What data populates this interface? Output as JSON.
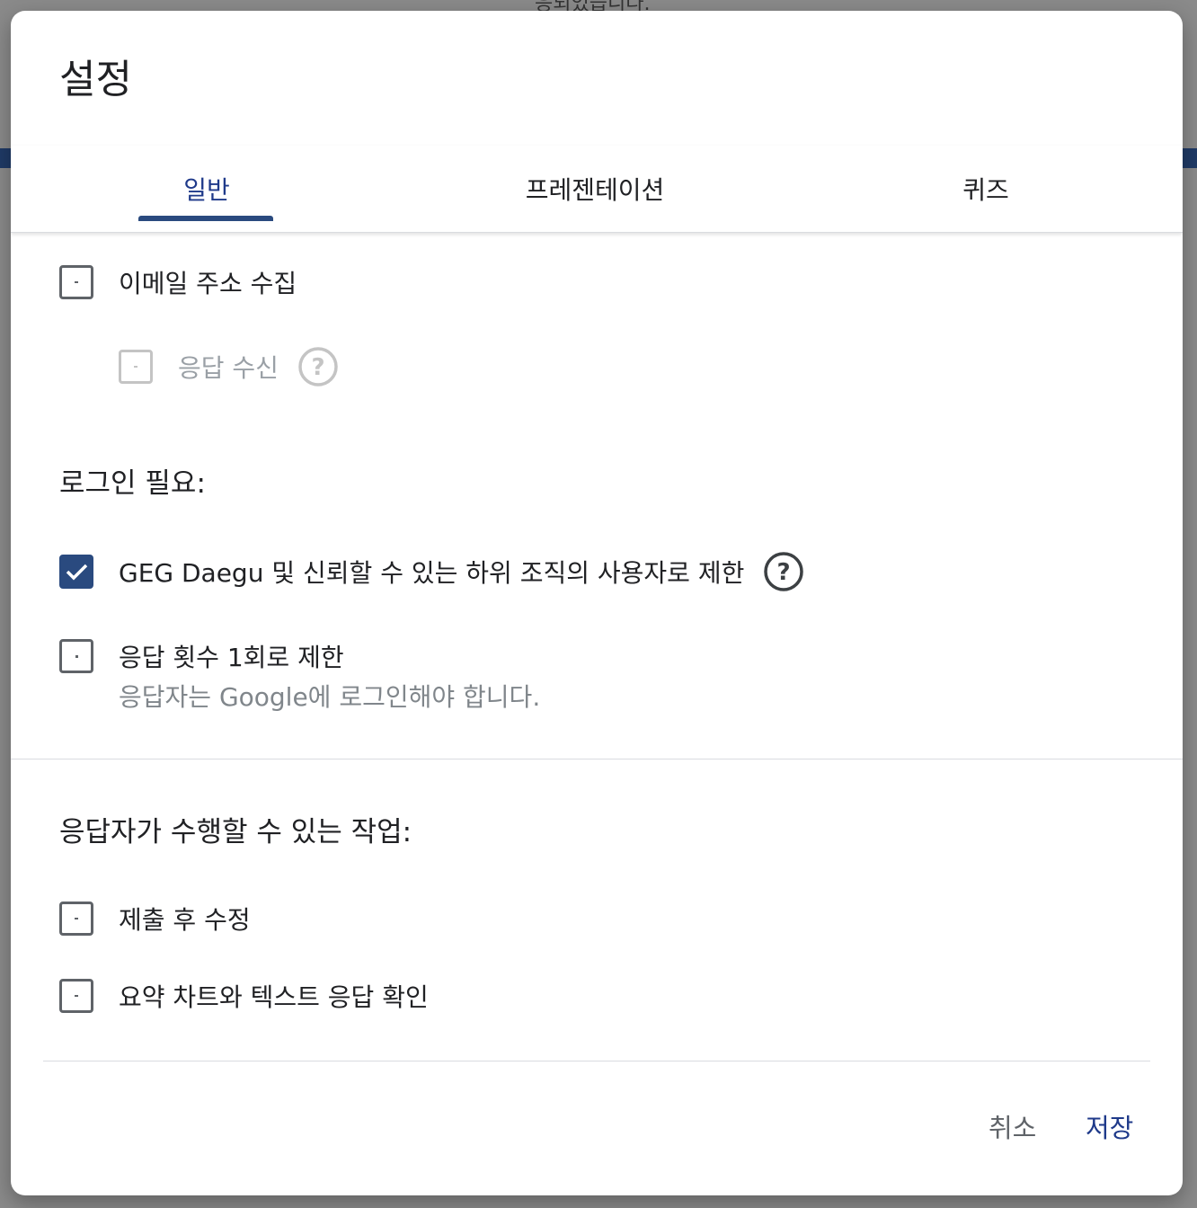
{
  "background": {
    "top_text": "응되었습니다."
  },
  "dialog": {
    "title": "설정",
    "tabs": [
      {
        "label": "일반",
        "active": true
      },
      {
        "label": "프레젠테이션",
        "active": false
      },
      {
        "label": "퀴즈",
        "active": false
      }
    ],
    "general": {
      "collect_email": {
        "label": "이메일 주소 수집",
        "checked": false
      },
      "response_receipt": {
        "label": "응답 수신",
        "checked": false,
        "disabled": true
      },
      "login_section": {
        "heading": "로그인 필요:",
        "restrict_users": {
          "label": "GEG Daegu 및 신뢰할 수 있는 하위 조직의 사용자로 제한",
          "checked": true
        },
        "limit_one_response": {
          "label": "응답 횟수 1회로 제한",
          "sublabel": "응답자는 Google에 로그인해야 합니다.",
          "checked": false
        }
      },
      "respondent_section": {
        "heading": "응답자가 수행할 수 있는 작업:",
        "edit_after_submit": {
          "label": "제출 후 수정",
          "checked": false
        },
        "see_summary": {
          "label": "요약 차트와 텍스트 응답 확인",
          "checked": false
        }
      }
    },
    "footer": {
      "cancel_label": "취소",
      "save_label": "저장"
    }
  },
  "colors": {
    "accent": "#2a4a7f",
    "tab_active_text": "#1f3a8a"
  }
}
